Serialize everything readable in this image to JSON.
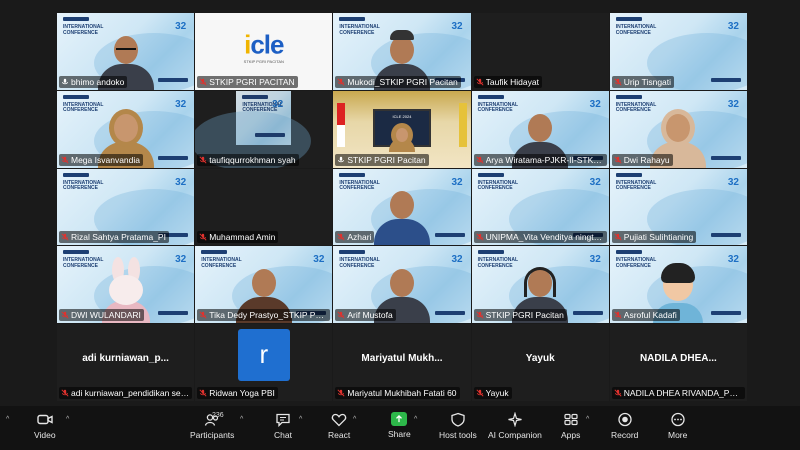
{
  "participants": [
    {
      "name": "bhimo andoko",
      "muted": false,
      "bg": "conf",
      "person": "plain",
      "active": true
    },
    {
      "name": "STKIP PGRI PACITAN",
      "muted": true,
      "bg": "icle",
      "person": "none"
    },
    {
      "name": "Mukodi_STKIP PGRI Pacitan",
      "muted": true,
      "bg": "conf",
      "person": "cap"
    },
    {
      "name": "Taufik Hidayat",
      "muted": true,
      "bg": "dark",
      "person": "none"
    },
    {
      "name": "Urip Tisngati",
      "muted": true,
      "bg": "conf",
      "person": "none"
    },
    {
      "name": "Mega Isvanvandia",
      "muted": true,
      "bg": "conf",
      "person": "hijab"
    },
    {
      "name": "taufiqqurrokhman syah",
      "muted": true,
      "bg": "dark-conf",
      "person": "none"
    },
    {
      "name": "STKIP PGRI Pacitan",
      "muted": false,
      "bg": "room",
      "person": "room"
    },
    {
      "name": "Arya Wiratama-PJKR-II-STK P...",
      "muted": true,
      "bg": "conf",
      "person": "plain"
    },
    {
      "name": "Dwi Rahayu",
      "muted": true,
      "bg": "conf",
      "person": "hijab2"
    },
    {
      "name": "Rizal Sahtya Pratama_PI",
      "muted": true,
      "bg": "conf",
      "person": "none"
    },
    {
      "name": "Muhammad Amin",
      "muted": true,
      "bg": "dark",
      "person": "none"
    },
    {
      "name": "Azhari",
      "muted": true,
      "bg": "conf",
      "person": "blue"
    },
    {
      "name": "UNIPMA_Vita Venditya ningtyas",
      "muted": true,
      "bg": "conf",
      "person": "none"
    },
    {
      "name": "Pujiati Sulihtianing",
      "muted": true,
      "bg": "conf",
      "person": "none"
    },
    {
      "name": "DWI WULANDARI",
      "muted": true,
      "bg": "conf",
      "person": "rabbit"
    },
    {
      "name": "Tika Dedy Prastyo_STKIP PGRI...",
      "muted": true,
      "bg": "conf",
      "person": "batik"
    },
    {
      "name": "Arif Mustofa",
      "muted": true,
      "bg": "conf",
      "person": "plain"
    },
    {
      "name": "STKIP PGRI Pacitan",
      "muted": true,
      "bg": "conf",
      "person": "headset"
    },
    {
      "name": "Asroful Kadafi",
      "muted": true,
      "bg": "conf",
      "person": "memoji"
    },
    {
      "name": "adi kurniawan_pendidikan sej...",
      "muted": true,
      "bg": "dark",
      "person": "none",
      "center": "adi  kurniawan_p..."
    },
    {
      "name": "Ridwan Yoga PBI",
      "muted": true,
      "bg": "dark",
      "person": "none",
      "avatar": "r"
    },
    {
      "name": "Mariyatul Mukhibah Fatati 60",
      "muted": true,
      "bg": "dark",
      "person": "none",
      "center": "Mariyatul  Mukh..."
    },
    {
      "name": "Yayuk",
      "muted": true,
      "bg": "dark",
      "person": "none",
      "center": "Yayuk"
    },
    {
      "name": "NADILA DHEA RIVANDA_PGS...",
      "muted": true,
      "bg": "dark",
      "person": "none",
      "center": "NADILA  DHEA..."
    }
  ],
  "conference_bg": {
    "title": "INTERNATIONAL CONFERENCE",
    "logo": "32"
  },
  "icle_bg": {
    "logo_i": "i",
    "logo_rest": "cle",
    "sub": "STKIP PGRI PACITAN"
  },
  "room_screen_title": "ICLE 2024",
  "toolbar": {
    "video": "Video",
    "participants": "Participants",
    "participants_count": "236",
    "chat": "Chat",
    "react": "React",
    "share": "Share",
    "host_tools": "Host tools",
    "ai_companion": "AI Companion",
    "apps": "Apps",
    "record": "Record",
    "more": "More"
  },
  "colors": {
    "active_border": "#3ec63e",
    "share_green": "#2db84a",
    "avatar_blue": "#1f6fd0",
    "muted_red": "#e0322e"
  }
}
